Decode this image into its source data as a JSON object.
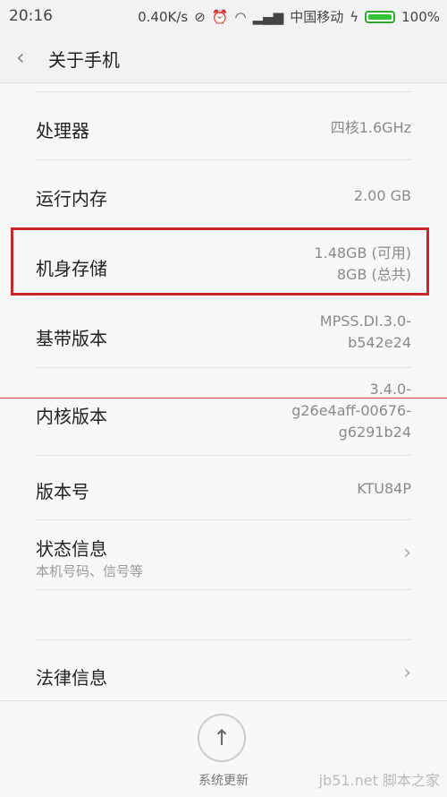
{
  "status_bar": {
    "time": "20:16",
    "net_speed": "0.40K/s",
    "carrier": "中国移动",
    "battery": "100%",
    "icons": [
      "vibrate-off-icon",
      "alarm-icon",
      "wifi-icon",
      "signal-icon",
      "charging-icon",
      "battery-icon"
    ]
  },
  "header": {
    "title": "关于手机",
    "back_icon": "‹"
  },
  "rows": {
    "processor": {
      "label": "处理器",
      "value": "四核1.6GHz"
    },
    "ram": {
      "label": "运行内存",
      "value": "2.00 GB"
    },
    "storage": {
      "label": "机身存储",
      "value_line1": "1.48GB (可用)",
      "value_line2": "8GB (总共)"
    },
    "baseband": {
      "label": "基带版本",
      "value_line1": "MPSS.DI.3.0-",
      "value_line2": "b542e24"
    },
    "kernel": {
      "label": "内核版本",
      "value_line1": "3.4.0-",
      "value_line2": "g26e4aff-00676-",
      "value_line3": "g6291b24"
    },
    "build": {
      "label": "版本号",
      "value": "KTU84P"
    },
    "status": {
      "label": "状态信息",
      "subtitle": "本机号码、信号等",
      "chevron": "›"
    },
    "legal": {
      "label": "法律信息",
      "chevron": "›"
    }
  },
  "bottom": {
    "button_label": "系统更新",
    "button_icon": "↑"
  },
  "watermark": "jb51.net 脚本之家",
  "colors": {
    "highlight": "#c8262d",
    "battery": "#36c236"
  }
}
